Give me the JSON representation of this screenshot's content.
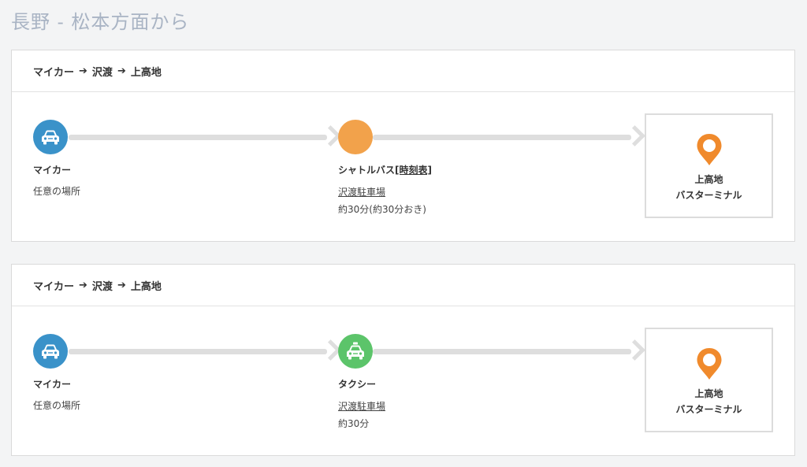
{
  "page": {
    "title": "長野 - 松本方面から"
  },
  "colors": {
    "car": "#3a92c9",
    "bus": "#f2a24b",
    "taxi": "#5cc46a",
    "pin": "#f08a2c",
    "line": "#dedede"
  },
  "routes": [
    {
      "header": {
        "part1": "マイカー",
        "part2": "沢渡",
        "part3": "上高地",
        "arrow": "➔"
      },
      "step1": {
        "icon": "car-icon",
        "label": "マイカー",
        "sub": "任意の場所"
      },
      "step2": {
        "icon": "bus-icon",
        "label": "シャトルバス",
        "timetable": "[時刻表]",
        "link": "沢渡駐車場",
        "time": "約30分(約30分おき)"
      },
      "destination": {
        "icon": "location-pin-icon",
        "line1": "上高地",
        "line2": "バスターミナル"
      }
    },
    {
      "header": {
        "part1": "マイカー",
        "part2": "沢渡",
        "part3": "上高地",
        "arrow": "➔"
      },
      "step1": {
        "icon": "car-icon",
        "label": "マイカー",
        "sub": "任意の場所"
      },
      "step2": {
        "icon": "taxi-icon",
        "label": "タクシー",
        "link": "沢渡駐車場",
        "time": "約30分"
      },
      "destination": {
        "icon": "location-pin-icon",
        "line1": "上高地",
        "line2": "バスターミナル"
      }
    }
  ]
}
